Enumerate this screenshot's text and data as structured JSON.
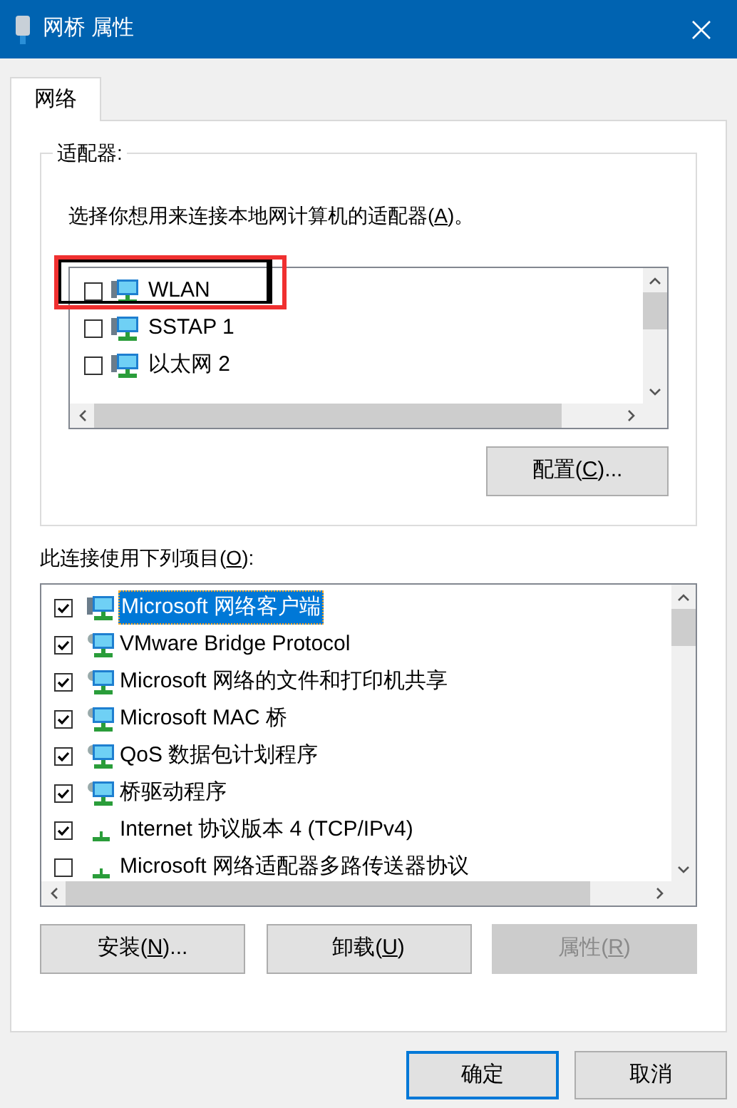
{
  "window": {
    "title": "网桥 属性"
  },
  "tabs": [
    {
      "label": "网络",
      "selected": true
    }
  ],
  "adapters_group": {
    "title": "适配器:",
    "hint": {
      "before": "选择你想用来连接本地网计算机的适配器(",
      "key": "A",
      "after": ")。"
    },
    "items": [
      {
        "name": "WLAN",
        "checked": false,
        "highlighted": true
      },
      {
        "name": "SSTAP 1",
        "checked": false,
        "highlighted": false
      },
      {
        "name": "以太网 2",
        "checked": false,
        "highlighted": false
      }
    ],
    "configure_button": {
      "before": "配置(",
      "key": "C",
      "after": ")..."
    }
  },
  "components": {
    "label": {
      "before": "此连接使用下列项目(",
      "key": "O",
      "after": "):"
    },
    "items": [
      {
        "name": "Microsoft 网络客户端",
        "checked": true,
        "selected": true,
        "kind": "client"
      },
      {
        "name": "VMware Bridge Protocol",
        "checked": true,
        "selected": false,
        "kind": "service"
      },
      {
        "name": "Microsoft 网络的文件和打印机共享",
        "checked": true,
        "selected": false,
        "kind": "service"
      },
      {
        "name": "Microsoft MAC 桥",
        "checked": true,
        "selected": false,
        "kind": "service"
      },
      {
        "name": "QoS 数据包计划程序",
        "checked": true,
        "selected": false,
        "kind": "service"
      },
      {
        "name": "桥驱动程序",
        "checked": true,
        "selected": false,
        "kind": "service"
      },
      {
        "name": "Internet 协议版本 4 (TCP/IPv4)",
        "checked": true,
        "selected": false,
        "kind": "protocol"
      },
      {
        "name": "Microsoft 网络适配器多路传送器协议",
        "checked": false,
        "selected": false,
        "kind": "protocol"
      }
    ]
  },
  "component_buttons": [
    {
      "before": "安装(",
      "key": "N",
      "after": ")...",
      "disabled": false
    },
    {
      "before": "卸载(",
      "key": "U",
      "after": ")",
      "disabled": false
    },
    {
      "before": "属性(",
      "key": "R",
      "after": ")",
      "disabled": true
    }
  ],
  "dialog_buttons": [
    {
      "label": "确定",
      "default": true
    },
    {
      "label": "取消",
      "default": false
    }
  ]
}
